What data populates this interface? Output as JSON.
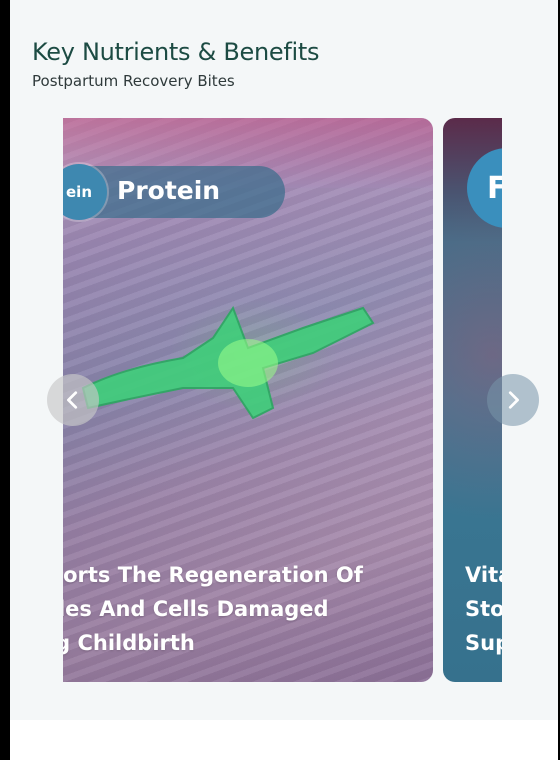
{
  "section": {
    "title": "Key Nutrients & Benefits",
    "subtitle": "Postpartum Recovery Bites"
  },
  "carousel": {
    "current_card": {
      "icon_text": "ein",
      "title": "Protein",
      "caption_lines": [
        "pports The Regeneration Of",
        "scles And Cells Damaged",
        "ing Childbirth"
      ]
    },
    "next_card": {
      "icon_text": "F",
      "caption_lines": [
        "Vita",
        "Sto",
        "Sup"
      ]
    },
    "prev_arrow_icon": "chevron-left-icon",
    "next_arrow_icon": "chevron-right-icon"
  },
  "colors": {
    "heading": "#1c4b43",
    "pill": "#3e88b0",
    "background": "#f4f7f8"
  }
}
